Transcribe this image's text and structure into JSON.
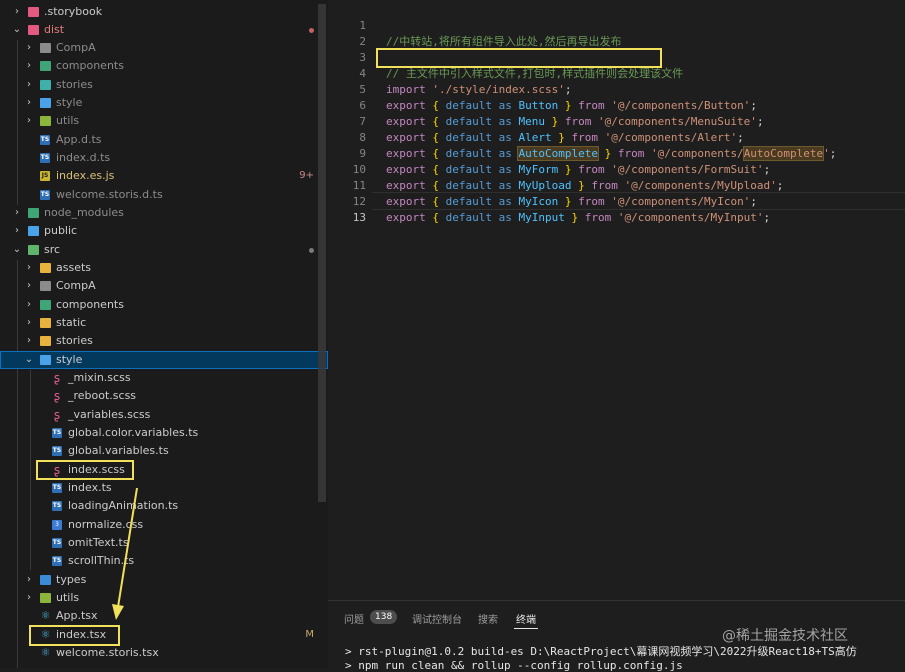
{
  "explorer": {
    "items": [
      {
        "label": ".storybook",
        "badge": ""
      },
      {
        "label": "dist",
        "badge": ""
      },
      {
        "label": "CompA",
        "badge": ""
      },
      {
        "label": "components",
        "badge": ""
      },
      {
        "label": "stories",
        "badge": ""
      },
      {
        "label": "style",
        "badge": ""
      },
      {
        "label": "utils",
        "badge": ""
      },
      {
        "label": "App.d.ts",
        "badge": ""
      },
      {
        "label": "index.d.ts",
        "badge": ""
      },
      {
        "label": "index.es.js",
        "badge": "9+"
      },
      {
        "label": "welcome.storis.d.ts",
        "badge": ""
      },
      {
        "label": "node_modules",
        "badge": ""
      },
      {
        "label": "public",
        "badge": ""
      },
      {
        "label": "src",
        "badge": ""
      },
      {
        "label": "assets",
        "badge": ""
      },
      {
        "label": "CompA",
        "badge": ""
      },
      {
        "label": "components",
        "badge": ""
      },
      {
        "label": "static",
        "badge": ""
      },
      {
        "label": "stories",
        "badge": ""
      },
      {
        "label": "style",
        "badge": ""
      },
      {
        "label": "_mixin.scss",
        "badge": ""
      },
      {
        "label": "_reboot.scss",
        "badge": ""
      },
      {
        "label": "_variables.scss",
        "badge": ""
      },
      {
        "label": "global.color.variables.ts",
        "badge": ""
      },
      {
        "label": "global.variables.ts",
        "badge": ""
      },
      {
        "label": "index.scss",
        "badge": ""
      },
      {
        "label": "index.ts",
        "badge": ""
      },
      {
        "label": "loadingAnimation.ts",
        "badge": ""
      },
      {
        "label": "normalize.css",
        "badge": ""
      },
      {
        "label": "omitText.ts",
        "badge": ""
      },
      {
        "label": "scrollThin.ts",
        "badge": ""
      },
      {
        "label": "types",
        "badge": ""
      },
      {
        "label": "utils",
        "badge": ""
      },
      {
        "label": "App.tsx",
        "badge": ""
      },
      {
        "label": "index.tsx",
        "badge": "M"
      },
      {
        "label": "welcome.storis.tsx",
        "badge": ""
      }
    ]
  },
  "editor": {
    "line_numbers": [
      "1",
      "2",
      "3",
      "4",
      "5",
      "6",
      "7",
      "8",
      "9",
      "10",
      "11",
      "12",
      "13"
    ],
    "comment1": "//中转站,将所有组件导入此处,然后再导出发布",
    "comment3": "// 主文件中引入样式文件,打包时,样式插件则会处理该文件",
    "import_kw": "import",
    "import_path": "'./style/index.scss'",
    "semicolon": ";",
    "exports": [
      {
        "name": "Button",
        "path": "'@/components/Button'"
      },
      {
        "name": "Menu",
        "path": "'@/components/MenuSuite'"
      },
      {
        "name": "Alert",
        "path": "'@/components/Alert'"
      },
      {
        "name": "AutoComplete",
        "path_pre": "'@/components/",
        "path_hl": "AutoComplete",
        "path_post": "'"
      },
      {
        "name": "MyForm",
        "path": "'@/components/FormSuit'"
      },
      {
        "name": "MyUpload",
        "path": "'@/components/MyUpload'"
      },
      {
        "name": "MyIcon",
        "path": "'@/components/MyIcon'"
      },
      {
        "name": "MyInput",
        "path": "'@/components/MyInput'"
      }
    ],
    "kw_export": "export",
    "kw_default": "default",
    "kw_as": "as",
    "kw_from": "from",
    "brace_open": "{",
    "brace_close": "}"
  },
  "panel": {
    "tabs": [
      "问题",
      "调试控制台",
      "搜索",
      "终端"
    ],
    "problems_count": "138",
    "terminal_line1": "> rst-plugin@1.0.2 build-es D:\\ReactProject\\幕课网视频学习\\2022升级React18+TS高仿",
    "terminal_line2": "> npm run clean && rollup --config rollup.config.js",
    "watermark": "@稀土掘金技术社区"
  },
  "colors": {
    "annotation": "#f1e05a"
  }
}
